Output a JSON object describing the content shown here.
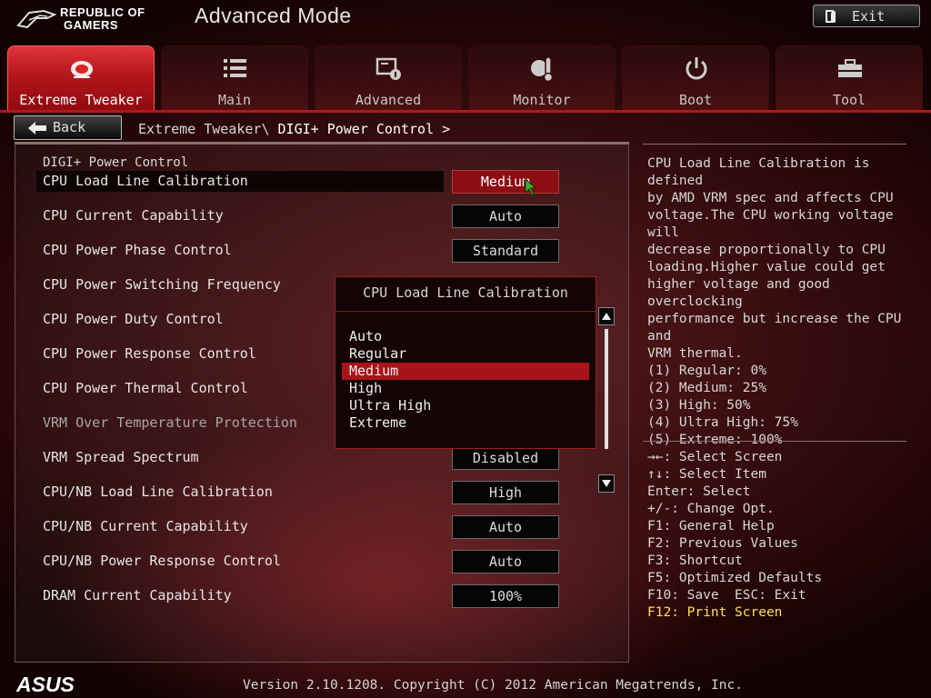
{
  "header": {
    "brand_line1": "REPUBLIC OF",
    "brand_line2": "GAMERS",
    "title": "Advanced Mode",
    "exit_label": "Exit"
  },
  "tabs": [
    {
      "label": "Extreme Tweaker",
      "icon": "extreme-tweaker-icon",
      "active": true
    },
    {
      "label": "Main",
      "icon": "list-icon"
    },
    {
      "label": "Advanced",
      "icon": "advanced-settings-icon"
    },
    {
      "label": "Monitor",
      "icon": "thermometer-icon"
    },
    {
      "label": "Boot",
      "icon": "power-icon"
    },
    {
      "label": "Tool",
      "icon": "toolbox-icon"
    }
  ],
  "nav": {
    "back_label": "Back",
    "breadcrumb_path": "Extreme Tweaker\\ ",
    "breadcrumb_current": "DIGI+ Power Control >"
  },
  "main": {
    "section_title": "DIGI+ Power Control",
    "rows": [
      {
        "label": "CPU Load Line Calibration",
        "value": "Medium"
      },
      {
        "label": "CPU Current Capability",
        "value": "Auto"
      },
      {
        "label": "CPU Power Phase Control",
        "value": "Standard"
      },
      {
        "label": "CPU Power Switching Frequency",
        "value": ""
      },
      {
        "label": "CPU Power Duty Control",
        "value": ""
      },
      {
        "label": "CPU Power Response Control",
        "value": ""
      },
      {
        "label": "CPU Power Thermal Control",
        "value": ""
      },
      {
        "label": "VRM Over Temperature Protection",
        "value": ""
      },
      {
        "label": "VRM Spread Spectrum",
        "value": "Disabled"
      },
      {
        "label": "CPU/NB Load Line Calibration",
        "value": "High"
      },
      {
        "label": "CPU/NB Current Capability",
        "value": "Auto"
      },
      {
        "label": "CPU/NB Power Response Control",
        "value": "Auto"
      },
      {
        "label": "DRAM Current Capability",
        "value": "100%"
      }
    ]
  },
  "popup": {
    "title": "CPU Load Line Calibration",
    "options": [
      "Auto",
      "Regular",
      "Medium",
      "High",
      "Ultra High",
      "Extreme"
    ],
    "selected": "Medium"
  },
  "help": {
    "description": "CPU Load Line Calibration is defined\nby AMD VRM spec and affects CPU\nvoltage.The CPU working voltage will\ndecrease proportionally to CPU\nloading.Higher value could get\nhigher voltage and good overclocking\nperformance but increase the CPU and\nVRM thermal.\n(1) Regular: 0%\n(2) Medium: 25%\n(3) High: 50%\n(4) Ultra High: 75%\n(5) Extreme: 100%",
    "keys": [
      "→←: Select Screen",
      "↑↓: Select Item",
      "Enter: Select",
      "+/-: Change Opt.",
      "F1: General Help",
      "F2: Previous Values",
      "F3: Shortcut",
      "F5: Optimized Defaults",
      "F10: Save  ESC: Exit"
    ],
    "print_screen": "F12: Print Screen"
  },
  "footer": {
    "brand": "ASUS",
    "version": "Version 2.10.1208. Copyright (C) 2012 American Megatrends, Inc."
  },
  "colors": {
    "accent_red": "#b3161c",
    "highlight_yellow": "#ffe14a"
  }
}
